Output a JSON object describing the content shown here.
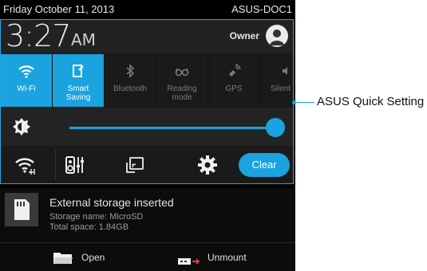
{
  "statusbar": {
    "date": "Friday October 11, 2013",
    "device": "ASUS-DOC1"
  },
  "quick_settings": {
    "time": "3:27",
    "ampm": "AM",
    "owner": "Owner",
    "tiles": [
      {
        "label": "Wi-Fi",
        "icon": "wifi-icon",
        "on": true
      },
      {
        "label": "Smart\nSaving",
        "icon": "smart-saving-icon",
        "on": true
      },
      {
        "label": "Bluetooth",
        "icon": "bluetooth-icon",
        "on": false
      },
      {
        "label": "Reading\nmode",
        "icon": "reading-mode-icon",
        "on": false
      },
      {
        "label": "GPS",
        "icon": "gps-icon",
        "on": false
      },
      {
        "label": "Silent",
        "icon": "silent-icon",
        "on": false
      }
    ],
    "brightness_level": 0.97,
    "clear_label": "Clear",
    "accent_color": "#1aa3de"
  },
  "notification": {
    "title": "External storage inserted",
    "storage_name": "Storage name: MicroSD",
    "total_space": "Total space: 1.84GB",
    "open_label": "Open",
    "unmount_label": "Unmount"
  },
  "callout": {
    "label": "ASUS Quick Setting"
  }
}
